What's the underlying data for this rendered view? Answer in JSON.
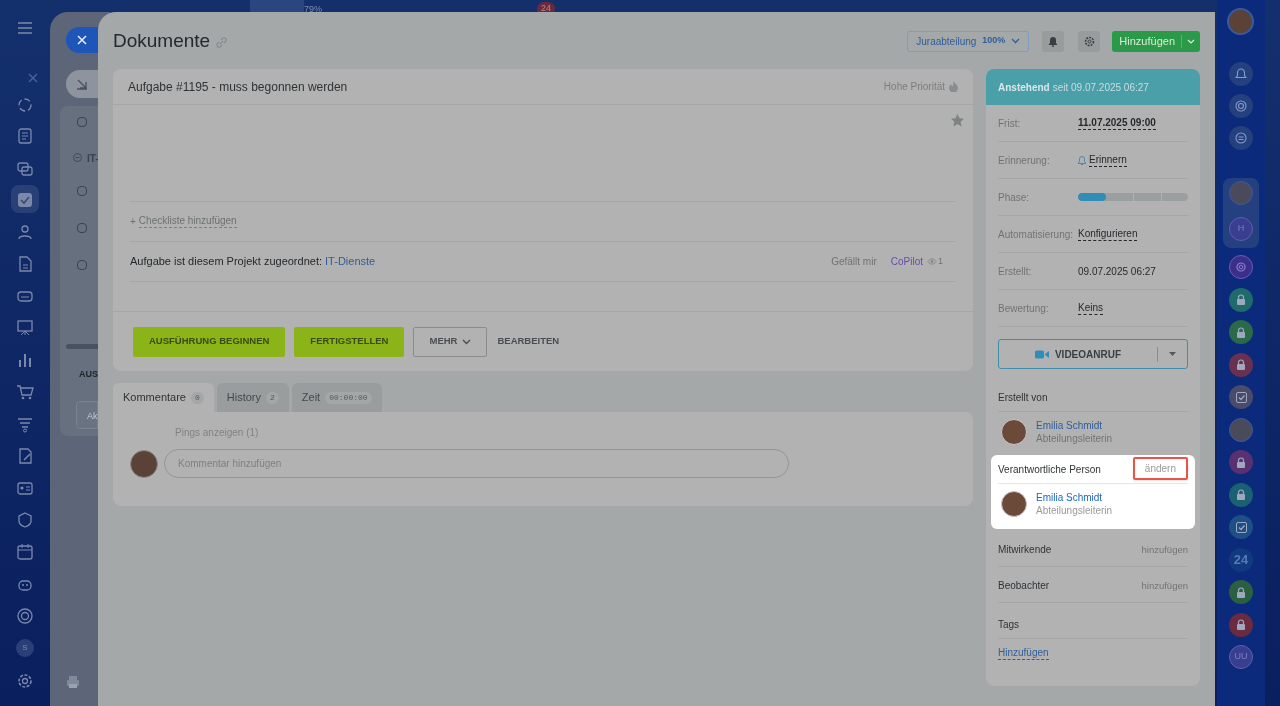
{
  "top_bar": {
    "texts": [
      "79%",
      "24"
    ]
  },
  "left_sidebar": {
    "user_initial": "S"
  },
  "background_list": {
    "checkboxes": [
      {
        "checked": false
      },
      {
        "checked": false
      },
      {
        "checked": false
      },
      {
        "checked": false
      }
    ],
    "group": "IT-",
    "footer_label": "AUS",
    "field_text": "Ak"
  },
  "header": {
    "title": "Dokumente",
    "department": {
      "label": "Juraabteilung",
      "percent": "100%"
    },
    "add_button": "Hinzufügen"
  },
  "task": {
    "title": "Aufgabe #1195 - muss begonnen werden",
    "priority": "Hohe Priorität",
    "checklist": {
      "plus": "+",
      "link": "Checkliste hinzufügen"
    },
    "project_label": "Aufgabe ist diesem Projekt zugeordnet:",
    "project": "IT-Dienste",
    "like": "Gefällt mir",
    "copilot": "CoPilot",
    "views": "1",
    "buttons": [
      {
        "label": "AUSFÜHRUNG BEGINNEN",
        "kind": "primary"
      },
      {
        "label": "FERTIGSTELLEN",
        "kind": "primary"
      },
      {
        "label": "MEHR",
        "kind": "dropdown"
      },
      {
        "label": "BEARBEITEN",
        "kind": "link"
      }
    ]
  },
  "tabs": [
    {
      "label": "Kommentare",
      "count": "0",
      "selected": true
    },
    {
      "label": "History",
      "count": "2",
      "selected": false
    },
    {
      "label": "Zeit",
      "count": "00:00:00",
      "selected": false
    }
  ],
  "comments": {
    "pings": "Pings anzeigen (1)",
    "placeholder": "Kommentar hinzufügen"
  },
  "details": {
    "status": {
      "label": "Anstehend",
      "since": "seit 09.07.2025 06:27"
    },
    "fields": [
      {
        "label": "Frist:",
        "value": "11.07.2025 09:00",
        "kind": "deadline"
      },
      {
        "label": "Erinnerung:",
        "value": "Erinnern",
        "kind": "reminder"
      },
      {
        "label": "Phase:",
        "kind": "phase",
        "level": 0.25
      },
      {
        "label": "Automatisierung:",
        "value": "Konfigurieren",
        "kind": "link"
      },
      {
        "label": "Erstellt:",
        "value": "09.07.2025 06:27",
        "kind": "text"
      },
      {
        "label": "Bewertung:",
        "value": "Keins",
        "kind": "link"
      }
    ],
    "video_button": "VIDEOANRUF",
    "roles": [
      {
        "title": "Erstellt von",
        "highlighted": false,
        "people": [
          {
            "name": "Emilia Schmidt",
            "position": "Abteilungsleiterin"
          }
        ]
      },
      {
        "title": "Verantwortliche Person",
        "action": "ändern",
        "highlighted": true,
        "people": [
          {
            "name": "Emilia Schmidt",
            "position": "Abteilungsleiterin"
          }
        ]
      },
      {
        "title": "Mitwirkende",
        "action": "hinzufügen",
        "highlighted": false
      },
      {
        "title": "Beobachter",
        "action": "hinzufügen",
        "highlighted": false
      }
    ],
    "tags": {
      "title": "Tags",
      "link": "Hinzufügen"
    }
  },
  "right_sidebar": {
    "items": [
      {
        "kind": "photo"
      },
      {
        "kind": "letter",
        "text": "H"
      },
      {
        "kind": "app",
        "color": "#3b2f8a"
      },
      {
        "kind": "lock",
        "color": "#1f6a6a"
      },
      {
        "kind": "lock",
        "color": "#2a6a48"
      },
      {
        "kind": "lock",
        "color": "#6a3050"
      },
      {
        "kind": "check",
        "color": "#4a4a6a"
      },
      {
        "kind": "photo"
      },
      {
        "kind": "lock",
        "color": "#5a3070"
      },
      {
        "kind": "lock",
        "color": "#1a6272"
      },
      {
        "kind": "check",
        "color": "#1e4f86"
      },
      {
        "kind": "number",
        "text": "24",
        "color": "#0f3a80"
      },
      {
        "kind": "lock",
        "color": "#2a6040"
      },
      {
        "kind": "lock",
        "color": "#6a2a40"
      },
      {
        "kind": "letter",
        "text": "UU"
      }
    ]
  }
}
